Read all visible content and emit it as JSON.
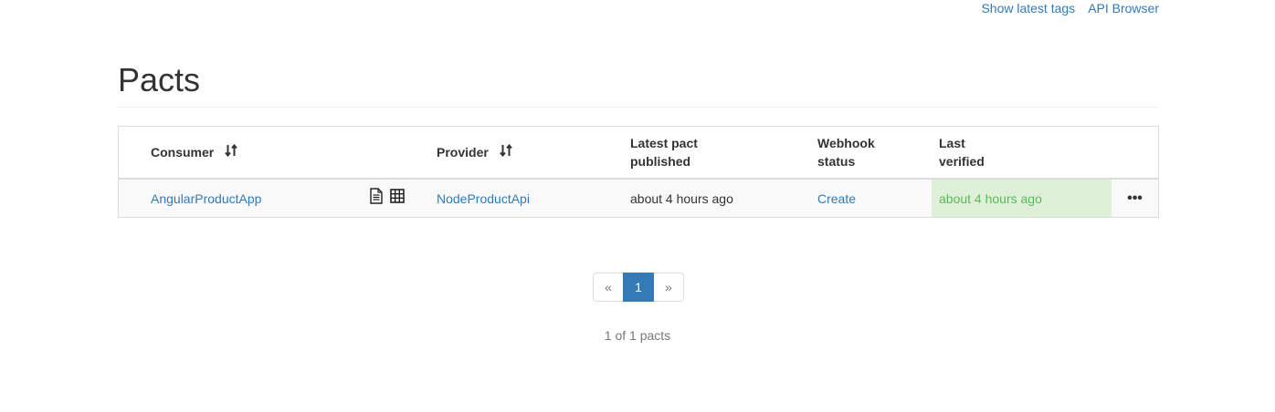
{
  "nav": {
    "show_latest_tags": "Show latest tags",
    "api_browser": "API Browser"
  },
  "page": {
    "title": "Pacts"
  },
  "table": {
    "headers": {
      "consumer": "Consumer",
      "provider": "Provider",
      "latest_pact_line1": "Latest pact",
      "latest_pact_line2": "published",
      "webhook_line1": "Webhook",
      "webhook_line2": "status",
      "last_verified_line1": "Last",
      "last_verified_line2": "verified"
    },
    "rows": [
      {
        "consumer": "AngularProductApp",
        "provider": "NodeProductApi",
        "latest_pact_published": "about 4 hours ago",
        "webhook_status": "Create",
        "last_verified": "about 4 hours ago",
        "actions": "•••",
        "icons": [
          "document-icon",
          "matrix-grid-icon"
        ]
      }
    ]
  },
  "pagination": {
    "prev": "«",
    "current": "1",
    "next": "»",
    "summary": "1 of 1 pacts"
  },
  "colors": {
    "link": "#337ab7",
    "verified_bg": "#dff0d8",
    "verified_text": "#5cb85c",
    "row_bg": "#f9f9f9"
  }
}
